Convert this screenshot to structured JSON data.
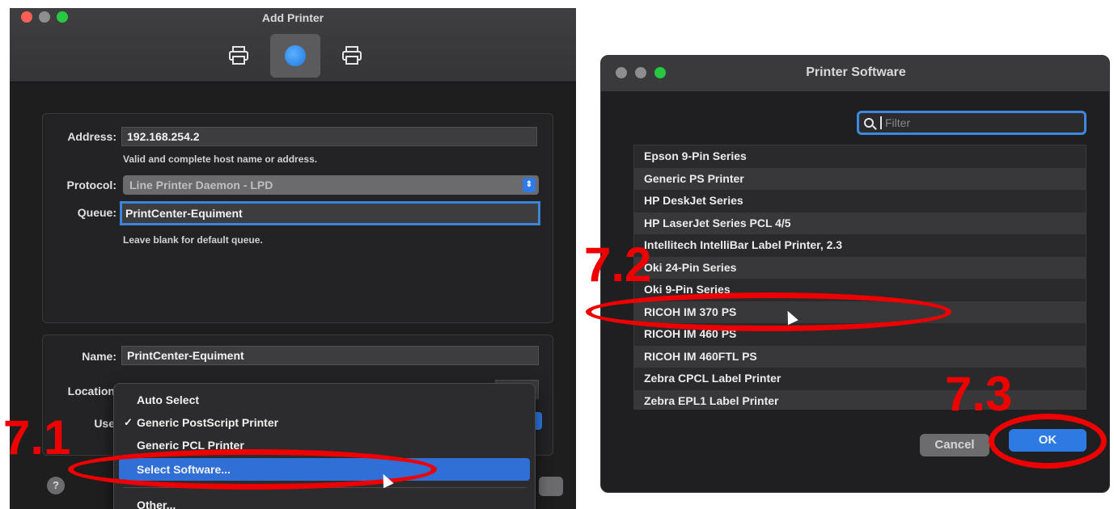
{
  "add_printer": {
    "title": "Add Printer",
    "address_label": "Address:",
    "address_value": "192.168.254.2",
    "address_hint": "Valid and complete host name or address.",
    "protocol_label": "Protocol:",
    "protocol_value": "Line Printer Daemon - LPD",
    "queue_label": "Queue:",
    "queue_value": "PrintCenter-Equiment",
    "queue_hint": "Leave blank for default queue.",
    "name_label": "Name:",
    "name_value": "PrintCenter-Equiment",
    "location_label": "Location",
    "use_label": "Use",
    "help_label": "?",
    "use_menu": {
      "items": [
        {
          "label": "Auto Select",
          "checked": false
        },
        {
          "label": "Generic PostScript Printer",
          "checked": true
        },
        {
          "label": "Generic PCL Printer",
          "checked": false
        },
        {
          "label": "Select Software...",
          "highlighted": true
        },
        {
          "label": "Other..."
        }
      ],
      "check_glyph": "✓"
    }
  },
  "printer_software": {
    "title": "Printer Software",
    "filter_placeholder": "Filter",
    "items": [
      "Epson 9-Pin Series",
      "Generic PS Printer",
      "HP DeskJet Series",
      "HP LaserJet Series PCL 4/5",
      "Intellitech IntelliBar Label Printer, 2.3",
      "Oki 24-Pin Series",
      "Oki 9-Pin Series",
      "RICOH IM 370 PS",
      "RICOH IM 460 PS",
      "RICOH IM 460FTL PS",
      "Zebra CPCL Label Printer",
      "Zebra EPL1 Label Printer"
    ],
    "cancel_label": "Cancel",
    "ok_label": "OK"
  },
  "annotations": {
    "step_1": "7.1",
    "step_2": "7.2",
    "step_3": "7.3",
    "color": "#ee0000"
  },
  "colors": {
    "accent": "#2d7ae3",
    "traffic_red": "#ff5f57",
    "traffic_yellow": "#8e8e8e",
    "traffic_green": "#28c840"
  }
}
